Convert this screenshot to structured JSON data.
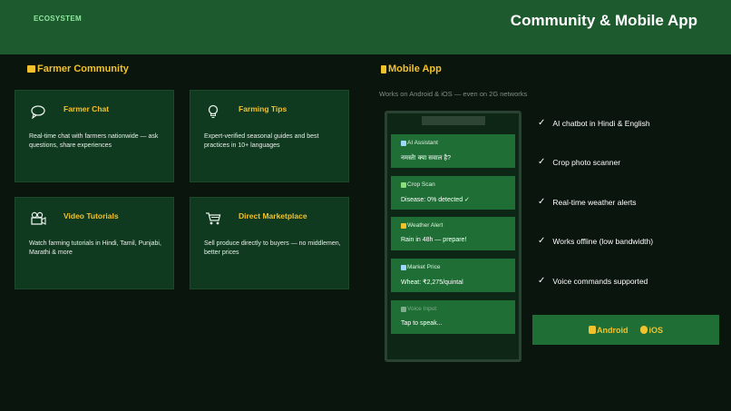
{
  "header": {
    "eyebrow": "ECOSYSTEM",
    "title": "Community & Mobile App"
  },
  "community": {
    "title": "Farmer Community",
    "icon": "people-icon",
    "cards": [
      {
        "title": "Farmer Chat",
        "icon": "chat-bubble-icon",
        "desc": "Real-time chat with farmers nationwide — ask questions, share experiences"
      },
      {
        "title": "Farming Tips",
        "icon": "lightbulb-icon",
        "desc": "Expert-verified seasonal guides and best practices in 10+ languages"
      },
      {
        "title": "Video Tutorials",
        "icon": "video-camera-icon",
        "desc": "Watch farming tutorials in Hindi, Tamil, Punjabi, Marathi & more"
      },
      {
        "title": "Direct Marketplace",
        "icon": "cart-icon",
        "desc": "Sell produce directly to buyers — no middlemen, better prices"
      }
    ]
  },
  "mobile": {
    "title": "Mobile App",
    "icon": "phone-icon",
    "subtitle": "Works on Android & iOS — even on 2G networks",
    "phone_cards": [
      {
        "title": "AI Assistant",
        "body": "नमस्ते! क्या सवाल है?",
        "icon": "robot-icon",
        "icon_color": "#9fd8ff"
      },
      {
        "title": "Crop Scan",
        "body": "Disease: 0% detected ✓",
        "icon": "leaf-icon",
        "icon_color": "#8be07a"
      },
      {
        "title": "Weather Alert",
        "body": "Rain in 48h — prepare!",
        "icon": "cloud-icon",
        "icon_color": "#f2c22c"
      },
      {
        "title": "Market Price",
        "body": "Wheat: ₹2,275/quintal",
        "icon": "chart-icon",
        "icon_color": "#9fd8ff"
      },
      {
        "title": "Voice Input",
        "body": "Tap to speak...",
        "icon": "microphone-icon",
        "icon_color": "#7fae8b"
      }
    ],
    "features": [
      "AI chatbot in Hindi & English",
      "Crop photo scanner",
      "Real-time weather alerts",
      "Works offline (low bandwidth)",
      "Voice commands supported"
    ],
    "check_symbol": "✓",
    "downloads": [
      {
        "label": "Android",
        "icon": "android-icon"
      },
      {
        "label": "iOS",
        "icon": "apple-icon"
      }
    ]
  },
  "colors": {
    "header_bg": "#1d5a2e",
    "accent": "#f2c22c",
    "card_bg": "#103a20",
    "phone_card_bg": "#1f6e35"
  }
}
